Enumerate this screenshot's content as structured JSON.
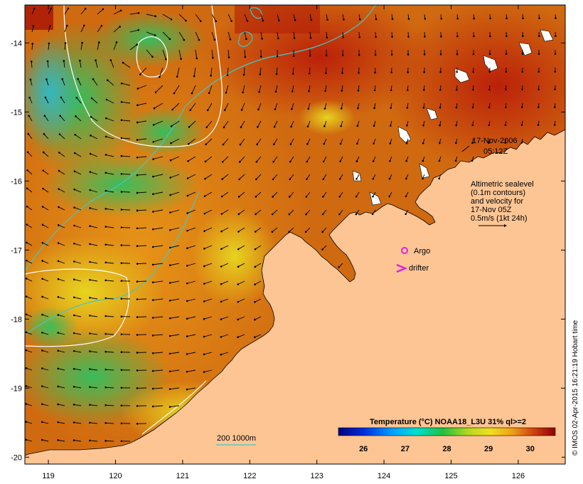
{
  "map": {
    "x_ticks": [
      "119",
      "120",
      "121",
      "122",
      "123",
      "124",
      "125",
      "126"
    ],
    "y_ticks": [
      "-14",
      "-15",
      "-16",
      "-17",
      "-18",
      "-19",
      "-20"
    ],
    "lon_range": [
      118.65,
      126.7
    ],
    "lat_range": [
      -20.1,
      -13.45
    ]
  },
  "annotations": {
    "date": "17-Nov-2006",
    "time": "05:12Z",
    "altimetry_lines": [
      "Altimetric sealevel",
      "(0.1m contours)",
      "and velocity for",
      "17-Nov 05Z",
      "0.5m/s (1kt 24h)"
    ],
    "argo_label": "Argo",
    "drifter_label": "drifter",
    "depth_legend": "200  1000m",
    "credit": "© IMOS 02-Apr-2015 16:21:19 Hobart time"
  },
  "colorbar": {
    "title": "Temperature (°C) NOAA18_L3U 31% ql>=2",
    "ticks": [
      "26",
      "27",
      "28",
      "29",
      "30"
    ],
    "range": [
      25.4,
      30.6
    ]
  },
  "colors": {
    "land": "#fdc594",
    "warm_water": "#a30505",
    "argo_marker": "#e020e0",
    "drifter_marker": "#e020e0",
    "isobath": "#40c8c8",
    "contour": "#ffffff"
  }
}
